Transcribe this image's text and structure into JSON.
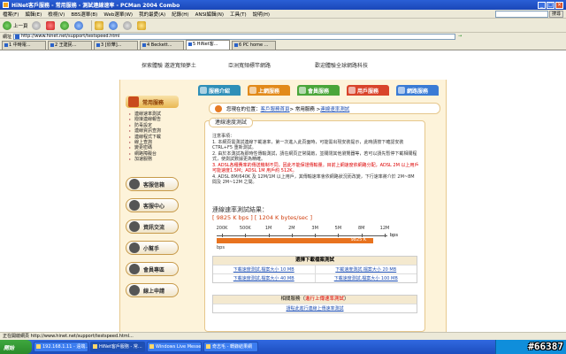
{
  "window": {
    "title": "HiNet客戶服務 - 常用服務 - 測試連線速率 - PCMan 2004 Combo"
  },
  "menu": {
    "items": [
      "檔案(F)",
      "編輯(E)",
      "檢視(V)",
      "BBS選單(B)",
      "Web選單(W)",
      "我的最愛(A)",
      "紀錄(H)",
      "ANSI編輯(N)",
      "工具(T)",
      "說明(H)"
    ],
    "search_placeholder": "",
    "search_go": "搜尋"
  },
  "toolbar": {
    "back": "上一頁",
    "forward": "",
    "stop": "",
    "refresh": "",
    "home": ""
  },
  "address": {
    "label": "網址",
    "url": "http://www.hinet.net/support/testspeed.html",
    "go": "→"
  },
  "tabs": [
    "1 中時電...",
    "2 王建民...",
    "3 [欣華]...",
    "4 Beckett...",
    "5 HiNet客...",
    "6 PC home ..."
  ],
  "header": {
    "slogans": [
      "探索體驗 邀遊寬頻夢土",
      "亞洲寬頻標竿網路",
      "歡迎體驗全球網路科技"
    ]
  },
  "navtabs": [
    "服務介紹",
    "上網服務",
    "會員服務",
    "用戶服務",
    "網路服務"
  ],
  "sidebar": {
    "head": "常用服務",
    "links": [
      "連線速率測試",
      "撥接連線報告",
      "防毒設定",
      "連線資訊查詢",
      "連線程式下載",
      "線上查詢",
      "變更密碼",
      "網路障礙台",
      "加速服務"
    ],
    "buttons": [
      "客服信箱",
      "客服中心",
      "資訊交流",
      "小幫手",
      "會員專區",
      "線上申請"
    ]
  },
  "breadcrumb": {
    "prefix": "您現在的位置：",
    "home": "客戶服務首頁",
    "sep1": " > 常用服務 > ",
    "current": "連線速率測試"
  },
  "panel": {
    "title": "連線速度測試",
    "notes_title": "注意事項：",
    "note1": "1. 本網頁需測試連線下載速率，第一次進入此頁面時，可能需出現安裝提示，此時請按下確認安裝 CTRL+F5 重新測試。",
    "note2": "2. 由於本測試為即時性傳輸測試，請在網頁正常開啟，並關閉其他瀏覽器等，若可以請先暫停下載相關程式，使測試數據更為精確。",
    "note3": "3. ADSL各種費率的傳送機制不同，因此不能保證傳輸量。目前上網速度依網路分配，ADSL 2M 以上用戶可能速度1.5M；ADSL 1M 用戶約 512K。",
    "note4": "4. ADSL 8M/640K 及 12M/1M 以上用戶，其傳輸速率會依網路狀況而改變，下行速率將介於 2M~8M 間及 2M~12M 之間。",
    "result_title": "連線速率測試結果：",
    "result_value": "[ 9825 K bps ] [ 1204 K bytes/sec ]"
  },
  "scale": {
    "ticks": [
      "200K",
      "500K",
      "1M",
      "2M",
      "3M",
      "5M",
      "8M",
      "12M"
    ],
    "unit": "bps",
    "bar_label": "9825 K",
    "bar_unit": "bps",
    "bar_fraction": 0.915
  },
  "downloads": {
    "head": "選擇下載檔案測試",
    "rows": [
      [
        "下載速度測試,檔案大小 10 MB",
        "下載速度測試,檔案大小 20 MB"
      ],
      [
        "下載速度測試,檔案大小 40 MB",
        "下載速度測試,檔案大小 100 MB"
      ]
    ]
  },
  "related": {
    "head_prefix": "相關服務（",
    "head_red": "進行上傳速率測試",
    "head_suffix": "）",
    "link": "請點此進行連線上傳速率測試"
  },
  "statusbar": {
    "text": "正在開啟網頁 http://www.hinet.net/support/testspeed.html..."
  },
  "taskbar": {
    "start": "開始",
    "items": [
      "192.168.1.11 - 遠端...",
      "HiNet客戶服務 - 常...",
      "Windows Live Messe...",
      "奇志毛 - 轉錄結果網"
    ]
  },
  "watermark": "#66387"
}
